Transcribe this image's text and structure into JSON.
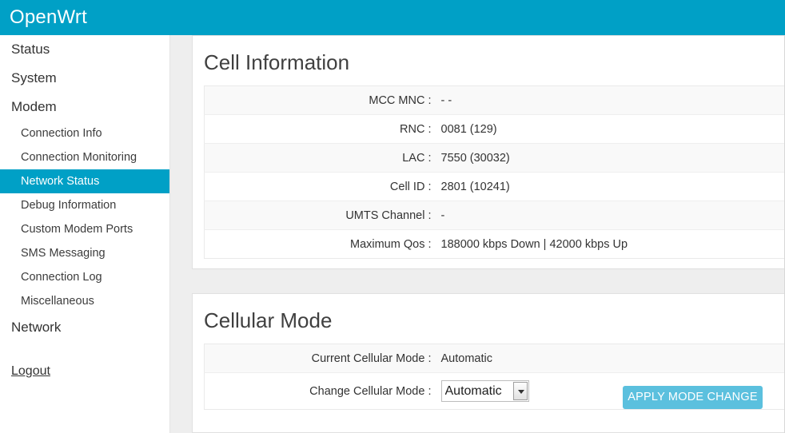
{
  "header": {
    "brand": "OpenWrt",
    "brand_color": "#00a0c6"
  },
  "sidebar": {
    "top_items": [
      {
        "label": "Status"
      },
      {
        "label": "System"
      },
      {
        "label": "Modem"
      }
    ],
    "modem_items": [
      {
        "label": "Connection Info",
        "active": false
      },
      {
        "label": "Connection Monitoring",
        "active": false
      },
      {
        "label": "Network Status",
        "active": true
      },
      {
        "label": "Debug Information",
        "active": false
      },
      {
        "label": "Custom Modem Ports",
        "active": false
      },
      {
        "label": "SMS Messaging",
        "active": false
      },
      {
        "label": "Connection Log",
        "active": false
      },
      {
        "label": "Miscellaneous",
        "active": false
      }
    ],
    "network_label": "Network",
    "logout_label": "Logout",
    "active_color": "#00a0c6"
  },
  "cell_information": {
    "title": "Cell Information",
    "rows": [
      {
        "label": "MCC MNC :",
        "value": "- -"
      },
      {
        "label": "RNC :",
        "value": "0081 (129)"
      },
      {
        "label": "LAC :",
        "value": "7550 (30032)"
      },
      {
        "label": "Cell ID :",
        "value": "2801 (10241)"
      },
      {
        "label": "UMTS Channel :",
        "value": "-"
      },
      {
        "label": "Maximum Qos :",
        "value": "188000 kbps Down | 42000 kbps Up"
      }
    ]
  },
  "cellular_mode": {
    "title": "Cellular Mode",
    "current_label": "Current Cellular Mode :",
    "current_value": "Automatic",
    "change_label": "Change Cellular Mode :",
    "selected_option": "Automatic",
    "options": [
      "Automatic"
    ],
    "apply_button": "APPLY MODE CHANGE",
    "apply_button_color": "#5bc0de"
  }
}
